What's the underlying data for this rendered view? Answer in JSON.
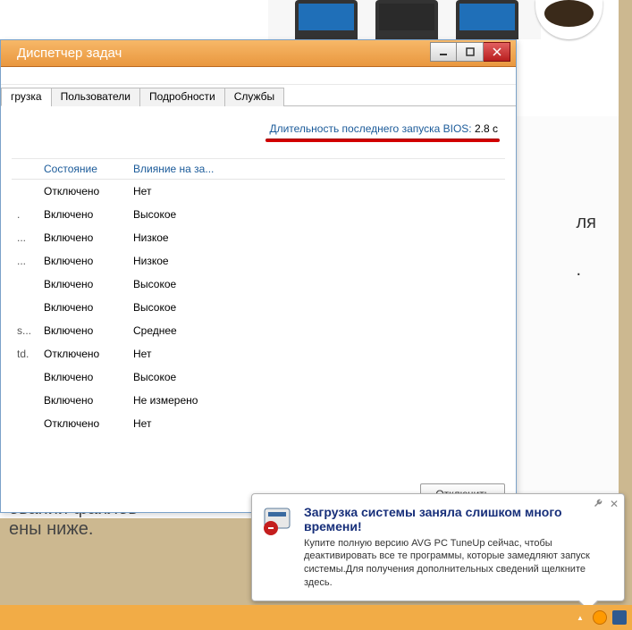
{
  "window": {
    "title": "Диспетчер задач"
  },
  "tabs": {
    "active": "грузка",
    "items": [
      "грузка",
      "Пользователи",
      "Подробности",
      "Службы"
    ]
  },
  "bios": {
    "label": "Длительность последнего запуска BIOS:",
    "value": "2.8 с"
  },
  "columns": {
    "name": "",
    "state": "Состояние",
    "impact": "Влияние на за..."
  },
  "rows": [
    {
      "name": "",
      "state": "Отключено",
      "impact": "Нет"
    },
    {
      "name": ".",
      "state": "Включено",
      "impact": "Высокое"
    },
    {
      "name": "...",
      "state": "Включено",
      "impact": "Низкое"
    },
    {
      "name": "...",
      "state": "Включено",
      "impact": "Низкое"
    },
    {
      "name": "",
      "state": "Включено",
      "impact": "Высокое"
    },
    {
      "name": "",
      "state": "Включено",
      "impact": "Высокое"
    },
    {
      "name": "s...",
      "state": "Включено",
      "impact": "Среднее"
    },
    {
      "name": "td.",
      "state": "Отключено",
      "impact": "Нет"
    },
    {
      "name": "",
      "state": "Включено",
      "impact": "Высокое"
    },
    {
      "name": "",
      "state": "Включено",
      "impact": "Не измерено"
    },
    {
      "name": "",
      "state": "Отключено",
      "impact": "Нет"
    }
  ],
  "footer": {
    "disable": "Отключить"
  },
  "article": {
    "line1": "ований файлов",
    "line2": "ены ниже.",
    "right1": "ля"
  },
  "notification": {
    "title": "Загрузка системы заняла слишком много времени!",
    "body": "Купите полную версию AVG PC TuneUp сейчас, чтобы деактивировать все те программы, которые замедляют запуск системы.Для получения дополнительных сведений щелкните здесь."
  }
}
